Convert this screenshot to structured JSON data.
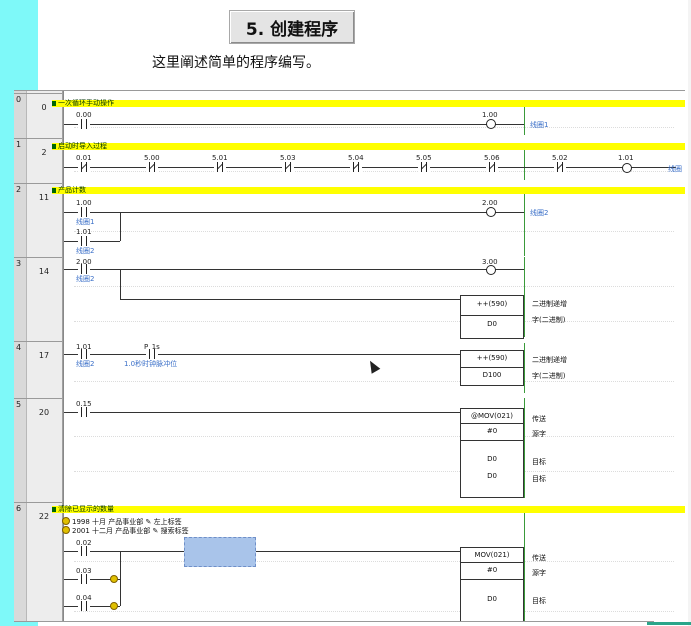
{
  "page": {
    "title": "5. 创建程序",
    "subtitle": "这里阐述简单的程序编写。"
  },
  "rungs": [
    {
      "index": "0",
      "step": "0",
      "comment": "一次循环手动操作"
    },
    {
      "index": "1",
      "step": "2",
      "comment": "启动时导入过程"
    },
    {
      "index": "2",
      "step": "11",
      "comment": "产品计数"
    },
    {
      "index": "3",
      "step": "14",
      "comment": ""
    },
    {
      "index": "4",
      "step": "17",
      "comment": ""
    },
    {
      "index": "5",
      "step": "20",
      "comment": ""
    },
    {
      "index": "6",
      "step": "22",
      "comment": "清除已显示的数量"
    }
  ],
  "r0": {
    "contact": "0.00",
    "coil": "1.00",
    "coil_label": "线圈1"
  },
  "r1": {
    "contacts": [
      "0.01",
      "5.00",
      "5.01",
      "5.03",
      "5.04",
      "5.05",
      "5.06",
      "5.02"
    ],
    "coil": "1.01",
    "coil_label": "线圈"
  },
  "r2": {
    "c1": "1.00",
    "c1_label": "线圈1",
    "c2": "1.01",
    "c2_label": "线圈2",
    "coil": "2.00",
    "coil_label": "线圈2"
  },
  "r3": {
    "contact": "2.00",
    "contact_label": "线圈2",
    "coil": "3.00",
    "func": "++(590)",
    "operand": "D0",
    "desc1": "二进制递增",
    "desc2": "字(二进制)"
  },
  "r4": {
    "c1": "1.01",
    "c1_label": "线圈2",
    "c2": "P_1s",
    "c2_label": "1.0秒时钟脉冲位",
    "func": "++(590)",
    "operand": "D100",
    "desc1": "二进制递增",
    "desc2": "字(二进制)"
  },
  "r5": {
    "contact": "0.15",
    "func": "@MOV(021)",
    "src": "#0",
    "dst1": "D0",
    "dst2": "D0",
    "lbl_func": "传送",
    "lbl_src": "源字",
    "lbl_dst": "目标",
    "lbl_dst2": "目标"
  },
  "r6": {
    "note1": "1998 十月 产品事业部 ✎ 左上标签",
    "note2": "2001 十二月 产品事业部 ✎ 搜索标签",
    "c1": "0.02",
    "c2": "0.03",
    "c3": "0.04",
    "func": "MOV(021)",
    "src": "#0",
    "dst": "D0",
    "lbl_func": "传送",
    "lbl_src": "源字",
    "lbl_dst": "目标"
  }
}
